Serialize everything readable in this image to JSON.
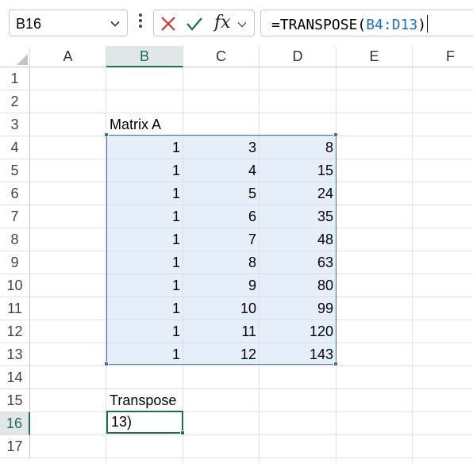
{
  "formula_bar": {
    "name_box": "B16",
    "fx_label": "fx",
    "formula_prefix": "=TRANSPOSE(",
    "formula_ref": "B4:D13",
    "formula_suffix": ")"
  },
  "columns": [
    "A",
    "B",
    "C",
    "D",
    "E",
    "F"
  ],
  "rows": [
    "1",
    "2",
    "3",
    "4",
    "5",
    "6",
    "7",
    "8",
    "9",
    "10",
    "11",
    "12",
    "13",
    "14",
    "15",
    "16",
    "17"
  ],
  "cells": {
    "matrix_label": "Matrix A",
    "matrix": [
      [
        "1",
        "3",
        "8"
      ],
      [
        "1",
        "4",
        "15"
      ],
      [
        "1",
        "5",
        "24"
      ],
      [
        "1",
        "6",
        "35"
      ],
      [
        "1",
        "7",
        "48"
      ],
      [
        "1",
        "8",
        "63"
      ],
      [
        "1",
        "9",
        "80"
      ],
      [
        "1",
        "10",
        "99"
      ],
      [
        "1",
        "11",
        "120"
      ],
      [
        "1",
        "12",
        "143"
      ]
    ],
    "transpose_label": "Transpose",
    "editing_text": "13)"
  },
  "colors": {
    "selected_header": "#1f7145",
    "range_border": "#3d6fc1",
    "range_fill": "#d2e0f6",
    "cancel_x": "#d13438",
    "enter_check": "#1f7145"
  }
}
